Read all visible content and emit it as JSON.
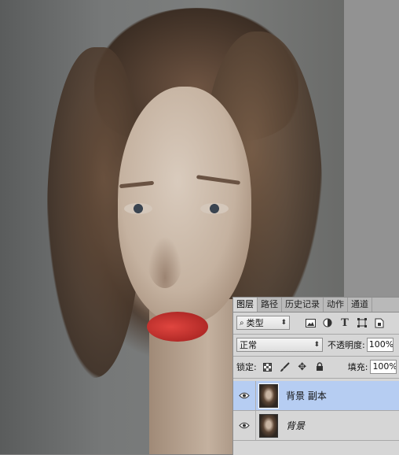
{
  "layers_panel": {
    "tabs": [
      "图层",
      "路径",
      "历史记录",
      "动作",
      "通道"
    ],
    "filter": {
      "label": "类型"
    },
    "blend_mode": "正常",
    "opacity_label": "不透明度:",
    "opacity_value": "100%",
    "lock_label": "锁定:",
    "fill_label": "填充:",
    "fill_value": "100%",
    "layers": [
      {
        "name": "背景 副本",
        "selected": true,
        "visible": true
      },
      {
        "name": "背景",
        "selected": false,
        "visible": true
      }
    ]
  }
}
